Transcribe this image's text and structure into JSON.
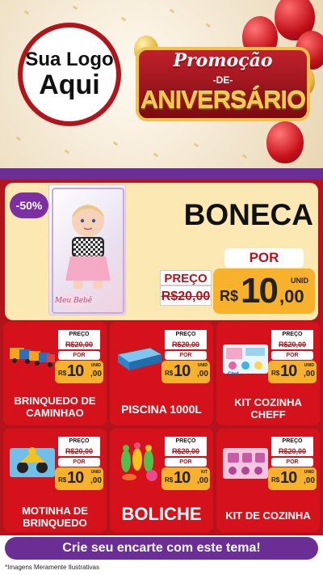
{
  "header": {
    "logo_line1": "Sua Logo",
    "logo_line2": "Aqui",
    "promo_line": "Promoção",
    "promo_de": "-DE-",
    "promo_aniversario": "ANIVERSÁRIO"
  },
  "featured": {
    "discount": "-50%",
    "box_brand": "Meu Bebê",
    "title": "BONECA",
    "preco_label": "PREÇO",
    "old_price": "R$20,00",
    "por_label": "POR",
    "currency": "R$",
    "price_int": "10",
    "price_cents": ",00",
    "unit": "UNID"
  },
  "products": [
    {
      "name": "BRINQUEDO DE CAMINHAO",
      "preco_label": "PREÇO",
      "old_price": "R$20,00",
      "por_label": "POR",
      "currency": "R$",
      "price_int": "10",
      "price_cents": ",00",
      "unit": "UNID"
    },
    {
      "name": "PISCINA 1000L",
      "preco_label": "PREÇO",
      "old_price": "R$20,00",
      "por_label": "POR",
      "currency": "R$",
      "price_int": "10",
      "price_cents": ",00",
      "unit": "UNID"
    },
    {
      "name": "KIT COZINHA CHEFF",
      "preco_label": "PREÇO",
      "old_price": "R$20,00",
      "por_label": "POR",
      "currency": "R$",
      "price_int": "10",
      "price_cents": ",00",
      "unit": "UNID"
    },
    {
      "name": "MOTINHA DE BRINQUEDO",
      "preco_label": "PREÇO",
      "old_price": "R$20,00",
      "por_label": "POR",
      "currency": "R$",
      "price_int": "10",
      "price_cents": ",00",
      "unit": "UNID"
    },
    {
      "name": "BOLICHE",
      "preco_label": "PREÇO",
      "old_price": "R$20,00",
      "por_label": "POR",
      "currency": "R$",
      "price_int": "10",
      "price_cents": ",00",
      "unit": "KIT"
    },
    {
      "name": "KIT DE COZINHA",
      "preco_label": "PREÇO",
      "old_price": "R$20,00",
      "por_label": "POR",
      "currency": "R$",
      "price_int": "10",
      "price_cents": ",00",
      "unit": "UNID"
    }
  ],
  "cta": {
    "label": "Crie seu encarte com este tema!"
  },
  "footer": {
    "disclaimer": "*Imagens Meramente Ilustrativas"
  },
  "colors": {
    "red": "#b3131b",
    "purple": "#6a2e95",
    "gold": "#f7b12a",
    "cream": "#fbe8b3"
  }
}
